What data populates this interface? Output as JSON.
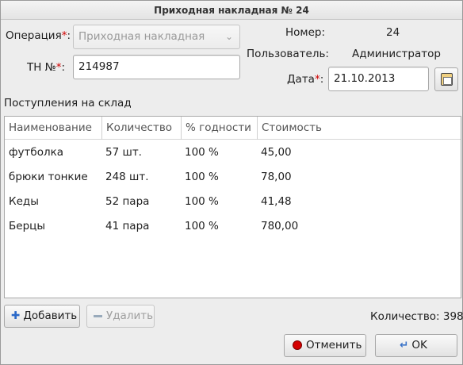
{
  "window": {
    "title": "Приходная накладная № 24"
  },
  "form": {
    "operation_label": "Операция",
    "operation_value": "Приходная накладная",
    "tn_label": "ТН №",
    "tn_value": "214987",
    "required_mark": "*",
    "number_label": "Номер:",
    "number_value": "24",
    "user_label": "Пользователь:",
    "user_value": "Администратор",
    "date_label": "Дата",
    "date_value": "21.10.2013"
  },
  "section": {
    "title": "Поступления на склад"
  },
  "table": {
    "columns": [
      "Наименование",
      "Количество",
      "% годности",
      "Стоимость"
    ],
    "rows": [
      [
        "футболка",
        "57 шт.",
        "100 %",
        "45,00"
      ],
      [
        "брюки тонкие",
        "248 шт.",
        "100 %",
        "78,00"
      ],
      [
        "Кеды",
        "52 пара",
        "100 %",
        "41,48"
      ],
      [
        "Берцы",
        "41 пара",
        "100 %",
        "780,00"
      ]
    ]
  },
  "toolbar": {
    "add_label": "Добавить",
    "delete_label": "Удалить",
    "count_text": "Количество: 398"
  },
  "footer": {
    "cancel_label": "Отменить",
    "ok_label": "OK"
  },
  "icons": {
    "calendar": "calendar-icon",
    "add": "plus-icon",
    "delete": "minus-icon",
    "cancel": "stop-icon",
    "ok": "enter-arrow-icon"
  },
  "colors": {
    "required": "#d00000",
    "cancel_icon": "#d40000"
  }
}
